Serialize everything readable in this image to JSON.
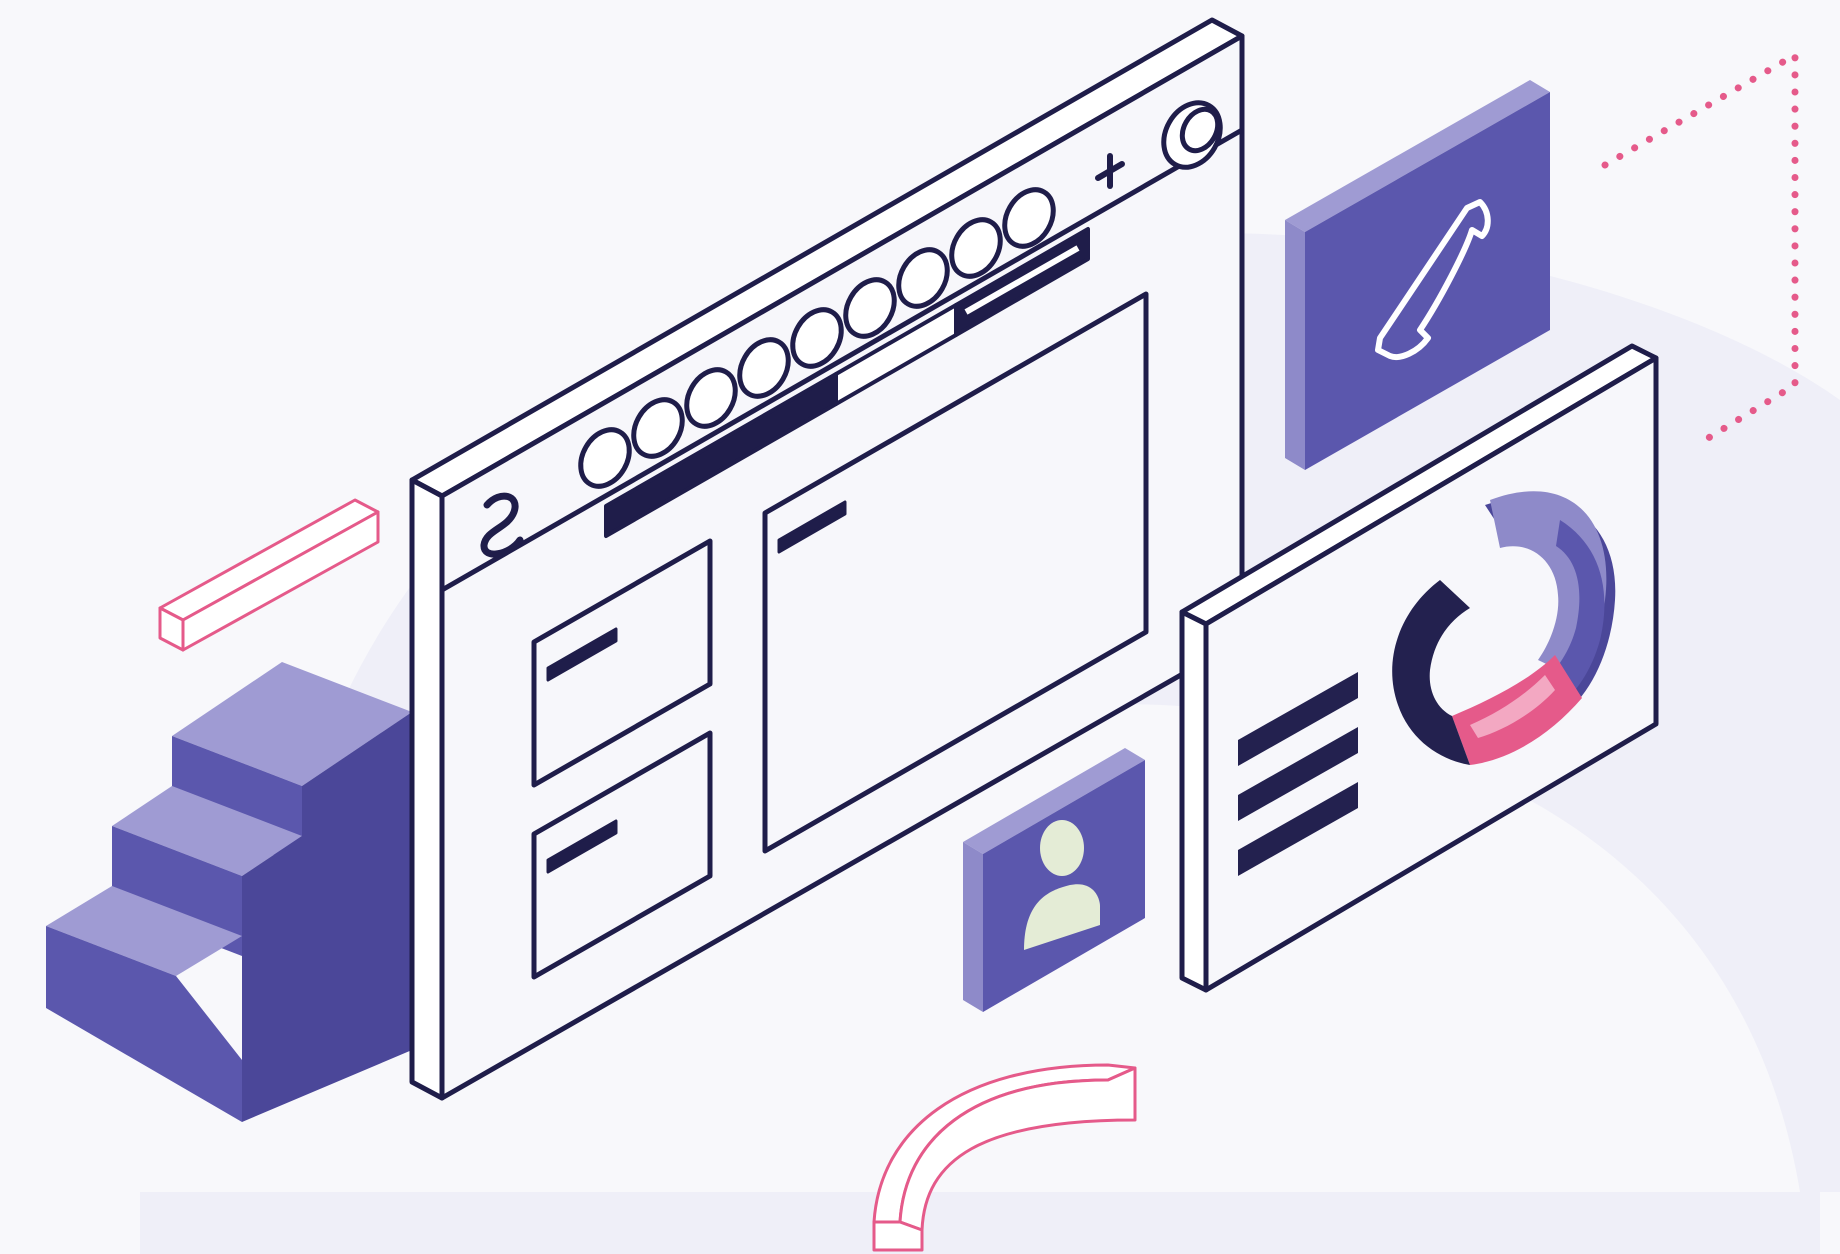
{
  "colors": {
    "background": "#f8f8fb",
    "blob": "#efeff8",
    "outline": "#1f1d4a",
    "panel": "#f7f7fb",
    "purple": "#5b57ad",
    "purple_light": "#8e8ac9",
    "purple_top": "#9f9bd3",
    "navy": "#23214f",
    "pink": "#e55a8a",
    "avatar": "#e4ecd6"
  },
  "illustration": {
    "app_window": {
      "logo_icon": "logo-icon",
      "tab_count": 9,
      "add_tab_icon": "plus-icon",
      "profile_icon": "profile-circle-icon"
    },
    "phone_tile_icon": "phone-icon",
    "user_tile_icon": "user-icon",
    "dashboard": {
      "text_lines": 3,
      "donut_segments": [
        {
          "name": "navy",
          "color": "#23214f"
        },
        {
          "name": "pink",
          "color": "#e55a8a"
        },
        {
          "name": "purple",
          "color": "#5b57ad"
        },
        {
          "name": "lavender",
          "color": "#8e8ac9"
        }
      ]
    }
  }
}
